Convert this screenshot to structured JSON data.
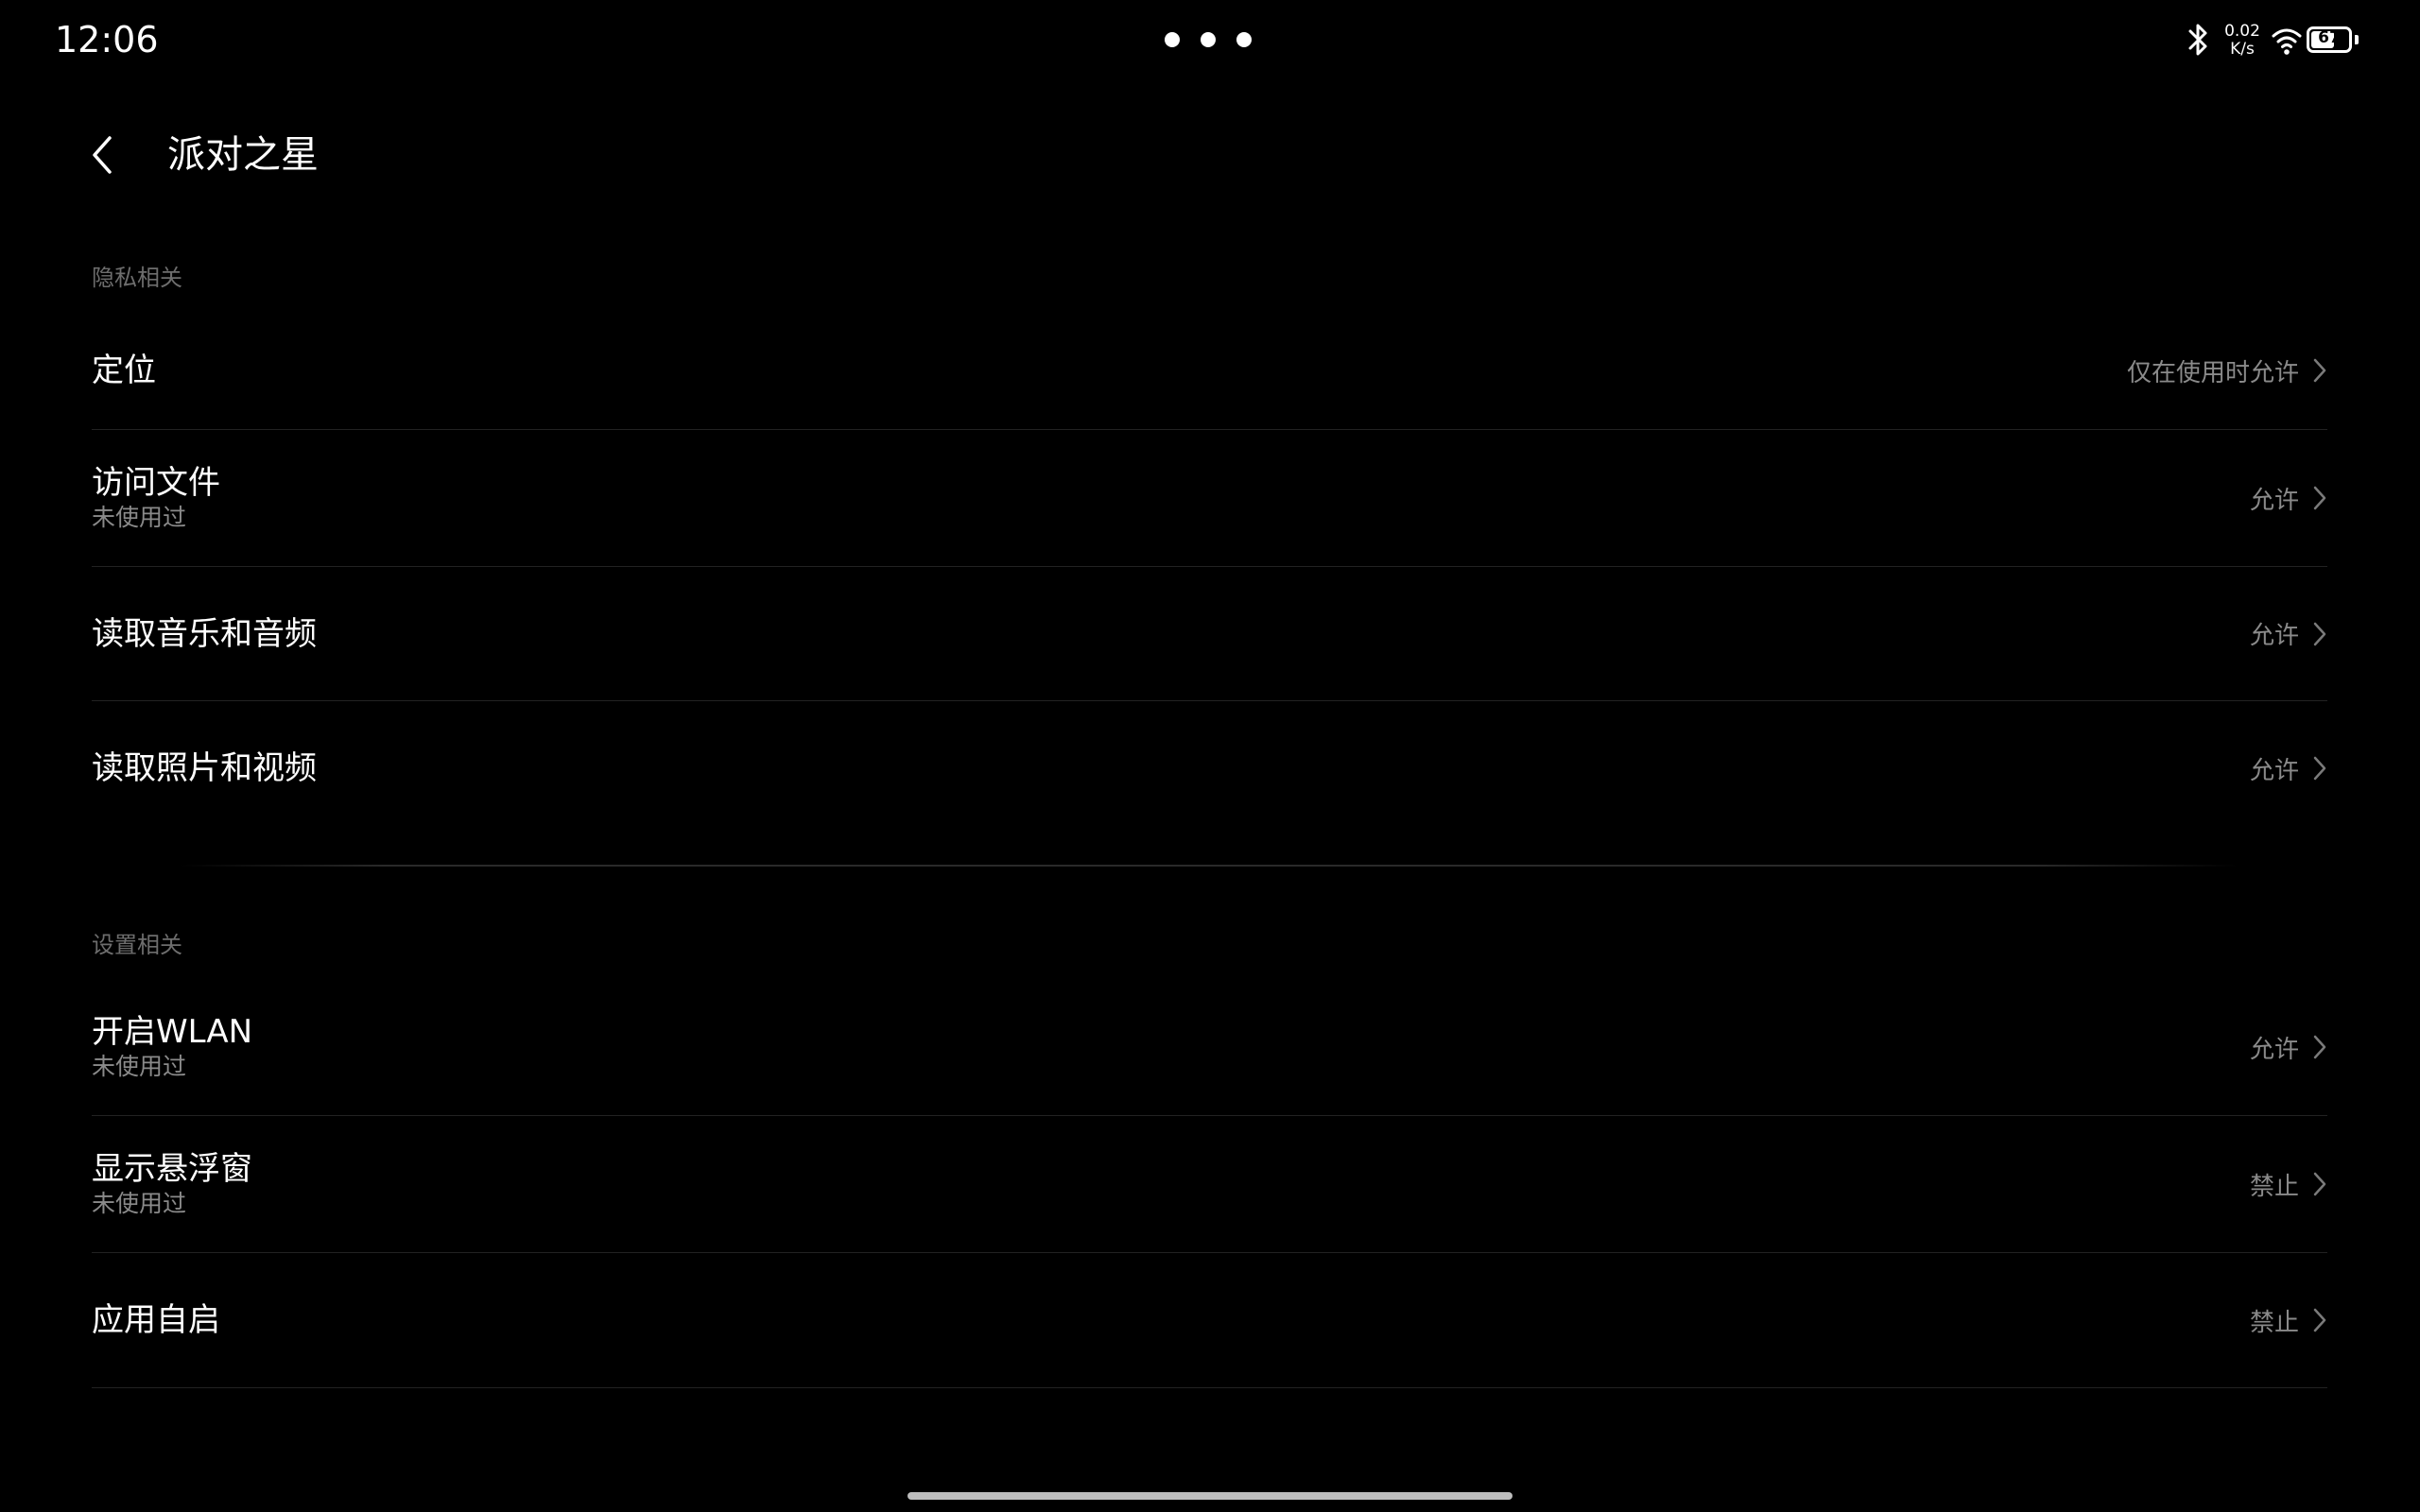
{
  "status_bar": {
    "time": "12:06",
    "net_speed_value": "0.02",
    "net_speed_unit": "K/s",
    "battery_level": "67",
    "battery_fraction": 0.67,
    "icons": [
      "bluetooth-icon",
      "wifi-icon",
      "battery-icon"
    ]
  },
  "header": {
    "title": "派对之星",
    "back_icon": "chevron-left-icon"
  },
  "sections": {
    "privacy": {
      "label": "隐私相关",
      "items": [
        {
          "title": "定位",
          "value": "仅在使用时允许"
        },
        {
          "title": "访问文件",
          "subtitle": "未使用过",
          "value": "允许"
        },
        {
          "title": "读取音乐和音频",
          "value": "允许"
        },
        {
          "title": "读取照片和视频",
          "value": "允许"
        }
      ]
    },
    "settings": {
      "label": "设置相关",
      "items": [
        {
          "title": "开启WLAN",
          "subtitle": "未使用过",
          "value": "允许"
        },
        {
          "title": "显示悬浮窗",
          "subtitle": "未使用过",
          "value": "禁止"
        },
        {
          "title": "应用自启",
          "value": "禁止"
        }
      ]
    }
  },
  "colors": {
    "background": "#000000",
    "primary_text": "#ffffff",
    "secondary_text": "#8a8a8a",
    "section_label": "#6d6d6d",
    "divider": "#222222"
  }
}
